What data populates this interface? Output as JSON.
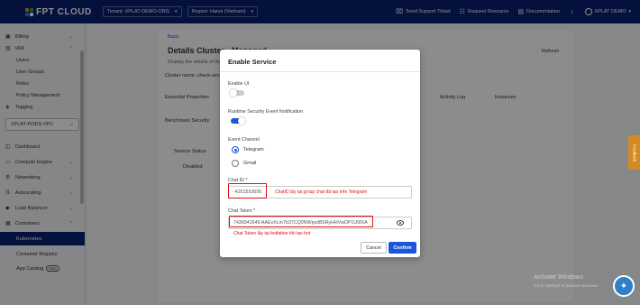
{
  "header": {
    "logo_text": "FPT CLOUD",
    "tenant_select": "Tenant: XPLAT-DEMO-ORG",
    "region_select": "Region: Hanoi (Vietnam)",
    "links": [
      {
        "icon": "support-icon",
        "label": "Send Support Ticket"
      },
      {
        "icon": "request-icon",
        "label": "Request Resource"
      },
      {
        "icon": "documentation-icon",
        "label": "Documentation"
      }
    ],
    "user": "XPLAT DEMO"
  },
  "sidebar": {
    "items_top": [
      {
        "icon": "billing-icon",
        "label": "Billing",
        "chevron": true
      },
      {
        "icon": "iam-icon",
        "label": "IAM",
        "chevron": true
      }
    ],
    "iam_sub": [
      "Users",
      "User Groups",
      "Roles",
      "Policy Management"
    ],
    "tagging": "Tagging",
    "vpc_select": "XPLAT-PODS-VPC",
    "items_bottom": [
      {
        "icon": "dashboard-icon",
        "label": "Dashboard",
        "chevron": false
      },
      {
        "icon": "compute-icon",
        "label": "Compute Engine",
        "chevron": true
      },
      {
        "icon": "networking-icon",
        "label": "Networking",
        "chevron": true
      },
      {
        "icon": "autoscaling-icon",
        "label": "Autoscaling",
        "chevron": true
      },
      {
        "icon": "load-balancer-icon",
        "label": "Load Balancer",
        "chevron": true
      },
      {
        "icon": "containers-icon",
        "label": "Containers",
        "chevron": true
      }
    ],
    "containers_sub": [
      "Kubernetes",
      "Container Registry",
      "App Catalog"
    ],
    "beta_badge": "beta"
  },
  "background": {
    "back": "Back",
    "title": "Details Cluster - Managed",
    "subtitle": "Display the details of the",
    "cluster_name": "Cluster name: check-secu",
    "refresh": "Refresh",
    "tabs": [
      "Essential Properties",
      "Activity Log",
      "Instances"
    ],
    "tab_benchmark": "Benchmark Security",
    "service_status": "Service Status",
    "disabled": "Disabled"
  },
  "modal": {
    "title": "Enable Service",
    "enable_ui_label": "Enable UI",
    "runtime_label": "Runtime Security Event Notification",
    "channel_label": "Event Channel",
    "channel_options": [
      "Telegram",
      "Gmail"
    ],
    "chat_id_label": "Chat ID *",
    "chat_id_value": "-4251553656",
    "chat_id_note": "ChatID lấy tại group chat đã tạo trên Telegram",
    "chat_token_label": "Chat Token *",
    "chat_token_value": "7436941649:AAEvXLm7b37CQ0NWpxdB0RyHHVwDP1U0fXA",
    "chat_token_note": "Chat Token lấy tại botfather khi tạo bot",
    "cancel": "Cancel",
    "confirm": "Confirm"
  },
  "feedback": "Feedback",
  "watermark": {
    "line1": "Activate Windows",
    "line2": "Go to Settings to activate Windows."
  },
  "colors": {
    "brand": "#0a1f6f",
    "accent": "#1a56db",
    "annotation": "#dd1111"
  }
}
